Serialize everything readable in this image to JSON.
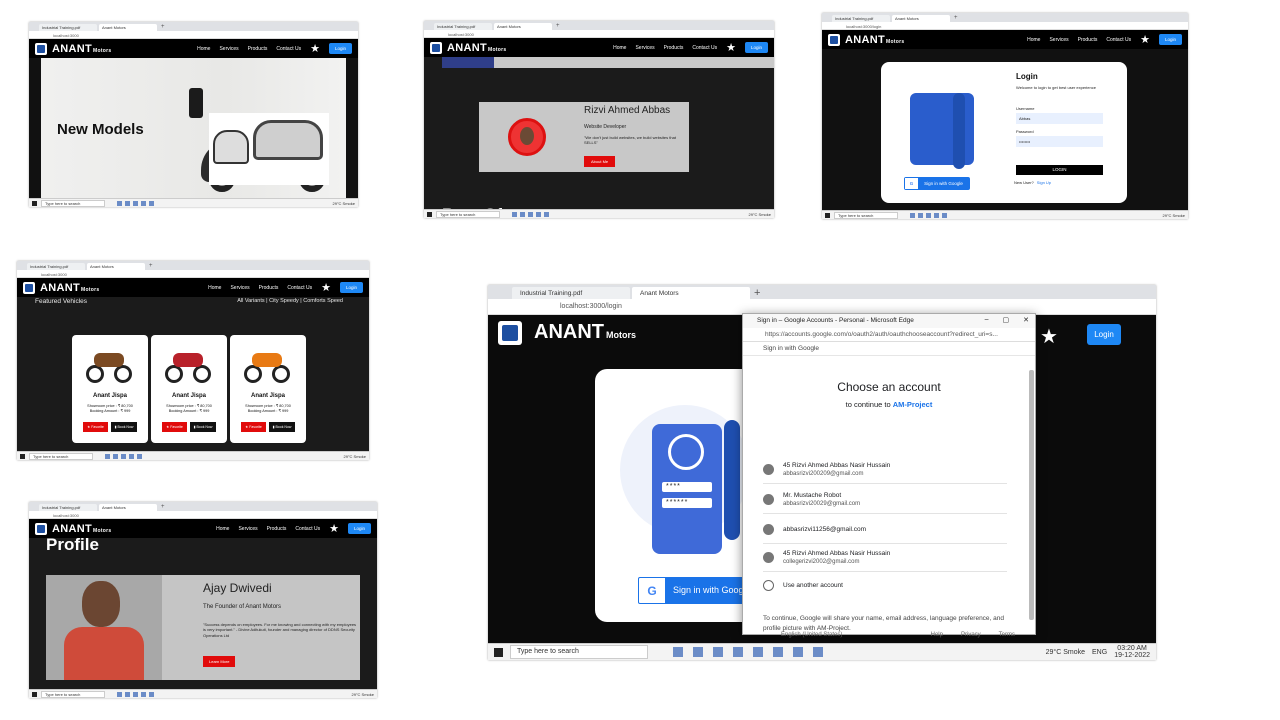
{
  "tabs": {
    "pdf": "Industrial Training.pdf",
    "site": "Anant Motors"
  },
  "address": {
    "home": "localhost:3000",
    "login": "localhost:3000/login"
  },
  "nav": {
    "brand": "ANANT",
    "brand_sub": "Motors",
    "items": [
      "Home",
      "Services",
      "Products",
      "Contact Us"
    ],
    "login": "Login"
  },
  "taskbar": {
    "search": "Type here to search",
    "weather": "29°C  Smoke",
    "lang": "ENG",
    "time": "03:20 AM",
    "date": "19-12-2022"
  },
  "shot1": {
    "heading": "New Models"
  },
  "shot2": {
    "name": "Rizvi Ahmed Abbas",
    "role": "Website Developer",
    "quote": "\"We don't just build websites, we build websites that SELLS\"",
    "button": "About Me",
    "next_heading": "Best Of"
  },
  "shot3": {
    "title": "Login",
    "subtitle": "Welcome to login to get best user experience",
    "username_label": "Username",
    "username_value": "Abbas",
    "password_label": "Password",
    "password_value": "••••••••",
    "login_button": "LOGIN",
    "google_button": "Sign in with Google",
    "new_user": "New User?",
    "signup": "Sign Up"
  },
  "shot4": {
    "heading": "Featured Vehicles",
    "filters": "All Variants  |  City Speedy  |  Comforts Speed",
    "vehicles": [
      {
        "name": "Anant Jispa",
        "showroom": "Showroom price : ₹ 80,700",
        "booking": "Booking Amount : ₹ 999",
        "fav": "Favorite",
        "book": "Book Now",
        "color": "#7b4a22"
      },
      {
        "name": "Anant Jispa",
        "showroom": "Showroom price : ₹ 80,700",
        "booking": "Booking Amount : ₹ 999",
        "fav": "Favorite",
        "book": "Book Now",
        "color": "#b8212a"
      },
      {
        "name": "Anant Jispa",
        "showroom": "Showroom price : ₹ 80,700",
        "booking": "Booking Amount : ₹ 999",
        "fav": "Favorite",
        "book": "Book Now",
        "color": "#e87a14"
      }
    ]
  },
  "shot5": {
    "heading": "Profile",
    "name": "Ajay Dwivedi",
    "role": "The Founder of Anant Motors",
    "quote": "\"Success depends on employees. For me knowing and connecting with my employees is very important.\" - Divine Aditukuti, founder and managing director of DDNS Security Operations Ltd",
    "button": "Learn More"
  },
  "popup": {
    "title": "Sign in – Google Accounts - Personal - Microsoft Edge",
    "url": "https://accounts.google.com/o/oauth2/auth/oauthchooseaccount?redirect_uri=s...",
    "header": "Sign in with Google",
    "heading": "Choose an account",
    "continue_prefix": "to continue to",
    "project": "AM-Project",
    "accounts": [
      {
        "name": "45 Rizvi Ahmed Abbas Nasir Hussain",
        "email": "abbasrizvi200209@gmail.com"
      },
      {
        "name": "Mr. Mustache Robot",
        "email": "abbasrizvi20029@gmail.com"
      },
      {
        "name": "",
        "email": "abbasrizvi11256@gmail.com"
      },
      {
        "name": "45 Rizvi Ahmed Abbas Nasir Hussain",
        "email": "collegerizvi2002@gmail.com"
      }
    ],
    "another": "Use another account",
    "note": "To continue, Google will share your name, email address, language preference, and profile picture with AM-Project.",
    "footer": {
      "language": "English (United States)",
      "help": "Help",
      "privacy": "Privacy",
      "terms": "Terms"
    }
  },
  "login_page": {
    "google_button": "Sign in with Google"
  }
}
